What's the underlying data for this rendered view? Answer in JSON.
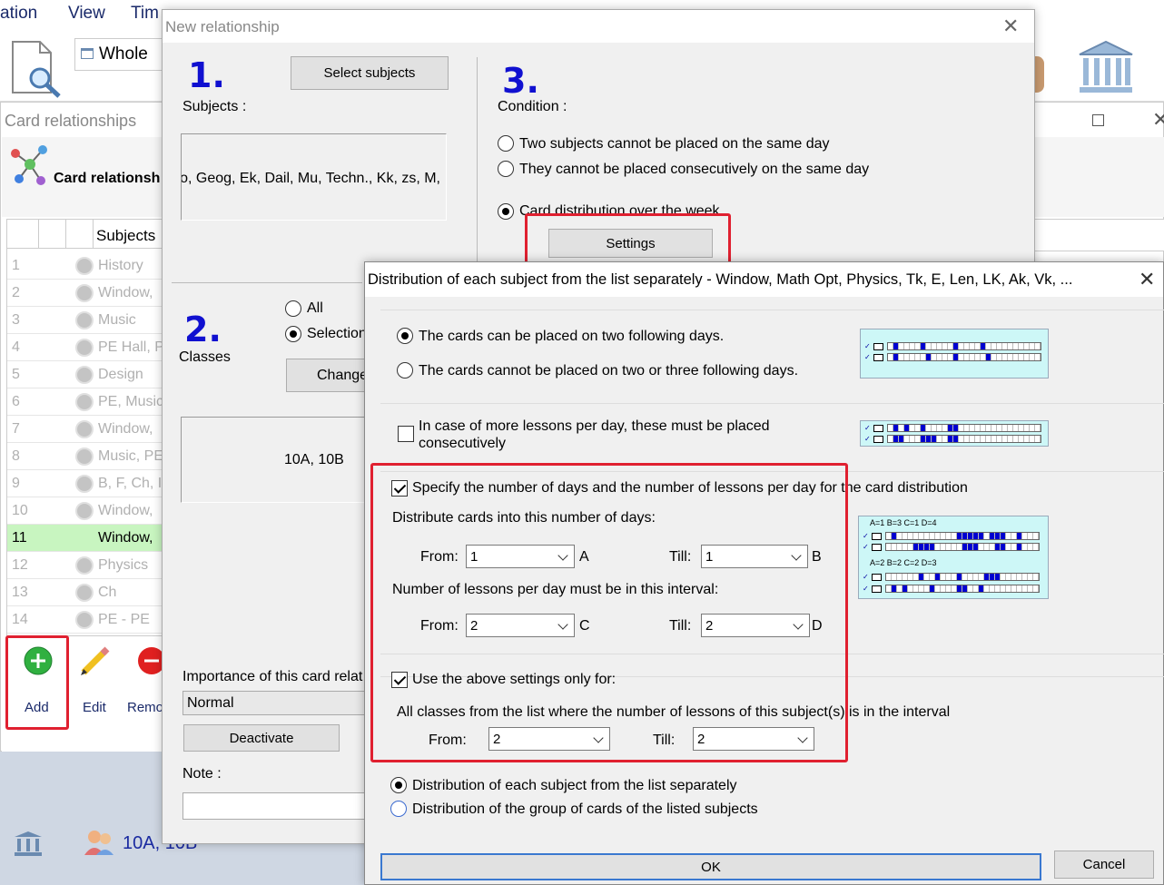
{
  "menu": {
    "items": [
      "ation",
      "View",
      "Tim"
    ]
  },
  "toolbar": {
    "view_value": "Whole"
  },
  "card_window": {
    "title": "Card relationships",
    "header_label": "Card relationsh",
    "col_subjects": "Subjects",
    "rows": [
      {
        "num": "1",
        "label": "History"
      },
      {
        "num": "2",
        "label": "Window,"
      },
      {
        "num": "3",
        "label": "Music"
      },
      {
        "num": "4",
        "label": "PE Hall, P"
      },
      {
        "num": "5",
        "label": "Design"
      },
      {
        "num": "6",
        "label": "PE, Music"
      },
      {
        "num": "7",
        "label": "Window,"
      },
      {
        "num": "8",
        "label": "Music, PE"
      },
      {
        "num": "9",
        "label": "B, F, Ch, I"
      },
      {
        "num": "10",
        "label": "Window,"
      },
      {
        "num": "11",
        "label": "Window,"
      },
      {
        "num": "12",
        "label": "Physics"
      },
      {
        "num": "13",
        "label": "Ch"
      },
      {
        "num": "14",
        "label": "PE - PE"
      }
    ],
    "add_label": "Add",
    "edit_label": "Edit",
    "remove_label": "Remo"
  },
  "status": {
    "classes": "10A, 10B"
  },
  "new_rel": {
    "title": "New relationship",
    "step1": "1.",
    "step2": "2.",
    "step3": "3.",
    "select_subjects_button": "Select subjects",
    "subjects_label": "Subjects :",
    "subjects_value": "o, Geog, Ek, Dail, Mu, Techn., Kk, zs, M,",
    "classes_label": "Classes",
    "all_label": "All",
    "selection_label": "Selection",
    "change_button": "Change",
    "classes_value": "10A, 10B",
    "condition_label": "Condition :",
    "cond1": "Two subjects cannot be placed on the same day",
    "cond2": "They cannot be placed consecutively on the same day",
    "cond3": "Card distribution over the week",
    "settings_button": "Settings",
    "importance_label": "Importance of this card relat",
    "importance_value": "Normal",
    "deactivate_button": "Deactivate",
    "note_label": "Note :"
  },
  "dist": {
    "title": "Distribution of each subject from the list separately - Window, Math Opt, Physics, Tk, E, Len, LK, Ak, Vk, ...",
    "opt_two_days": "The cards can be placed on two following days.",
    "opt_not_two_three": "The cards cannot be placed on two or three following days.",
    "opt_consecutive": "In case of more lessons per day, these must be placed consecutively",
    "specify_label": "Specify the number of days and the number of lessons per day for the card distribution",
    "distribute_label": "Distribute cards into this number of days:",
    "from_label": "From:",
    "till_label": "Till:",
    "days_from": "1",
    "days_till": "1",
    "letter_a": "A",
    "letter_b": "B",
    "lessons_label": "Number of lessons per day must be in this interval:",
    "lessons_from": "2",
    "lessons_till": "2",
    "letter_c": "C",
    "letter_d": "D",
    "use_only_label": "Use the above settings only for:",
    "all_classes_label": "All classes from the list where the number of lessons of this subject(s) is in the interval",
    "classes_from": "2",
    "classes_till": "2",
    "dist_separately": "Distribution of each subject from the list separately",
    "dist_group": "Distribution of the group of cards of the listed subjects",
    "ok_button": "OK",
    "cancel_button": "Cancel",
    "preview_text1": "A=1 B=3 C=1 D=4",
    "preview_text2": "A=2 B=2 C=2 D=3"
  },
  "colors": {
    "accent_blue": "#1010d0",
    "highlight_red": "#e02030",
    "selected_row": "#c8f5c0",
    "preview_bg": "#cdf7f7"
  }
}
